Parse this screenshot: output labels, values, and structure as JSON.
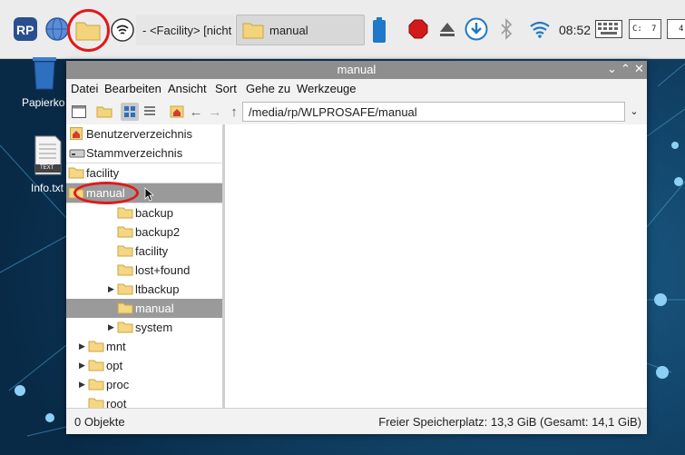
{
  "taskbar": {
    "task_facility": "- <Facility> [nicht ..",
    "task_manual": "manual",
    "clock": "08:52",
    "cpu_label": "C:",
    "cpu_value": "7",
    "extra": "4"
  },
  "desktop": {
    "trash_label": "Papierko",
    "file_label": "Info.txt",
    "file_badge": "TEXT"
  },
  "window": {
    "title": "manual",
    "controls": {
      "minimize": "⌄",
      "maximize": "⌃",
      "close": "✕"
    },
    "menu": [
      "Datei",
      "Bearbeiten",
      "Ansicht",
      "Sort",
      "Gehe zu",
      "Werkzeuge"
    ],
    "path": "/media/rp/WLPROSAFE/manual",
    "tree": [
      {
        "label": "Benutzerverzeichnis",
        "icon": "home-icon"
      },
      {
        "label": "Stammverzeichnis",
        "icon": "drive-icon"
      },
      {
        "label": "facility",
        "icon": "folder-icon"
      },
      {
        "label": "manual",
        "icon": "folder-icon",
        "selected": true
      },
      {
        "label": "backup",
        "icon": "folder-icon"
      },
      {
        "label": "backup2",
        "icon": "folder-icon"
      },
      {
        "label": "facility",
        "icon": "folder-icon"
      },
      {
        "label": "lost+found",
        "icon": "folder-icon"
      },
      {
        "label": "ltbackup",
        "icon": "folder-icon",
        "expandable": true
      },
      {
        "label": "manual",
        "icon": "folder-icon",
        "selected": true
      },
      {
        "label": "system",
        "icon": "folder-icon",
        "expandable": true
      },
      {
        "label": "mnt",
        "icon": "folder-icon",
        "expandable": true
      },
      {
        "label": "opt",
        "icon": "folder-icon",
        "expandable": true
      },
      {
        "label": "proc",
        "icon": "folder-icon",
        "expandable": true
      },
      {
        "label": "root",
        "icon": "folder-icon"
      }
    ],
    "status_left": "0 Objekte",
    "status_right": "Freier Speicherplatz: 13,3 GiB (Gesamt: 14,1 GiB)"
  },
  "colors": {
    "desktop": "#0c3658",
    "selection": "#9a9a9a",
    "titlebar": "#8e8e8e",
    "highlight_circle": "#e0191b",
    "folder": "#f5d682"
  }
}
